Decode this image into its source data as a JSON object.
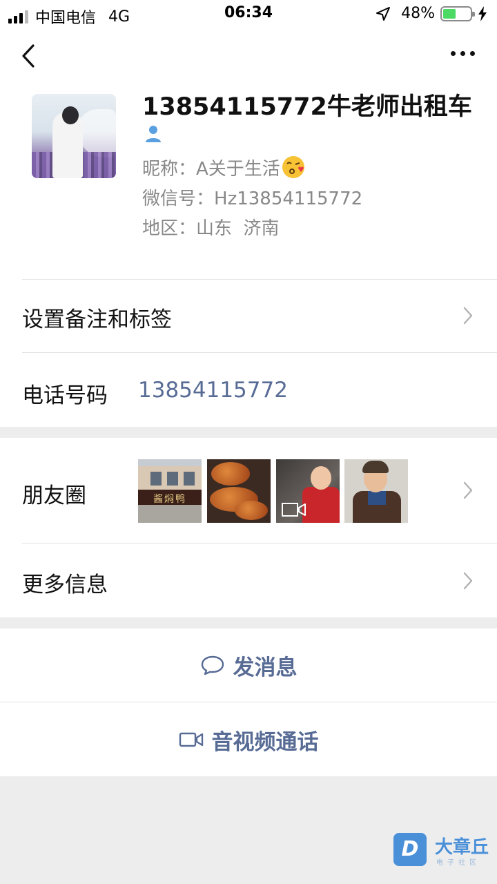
{
  "status_bar": {
    "carrier": "中国电信",
    "network": "4G",
    "time": "06:34",
    "battery": "48%",
    "battery_level": 0.48,
    "icons": [
      "signal-icon",
      "location-arrow-icon",
      "battery-icon",
      "charging-bolt-icon"
    ]
  },
  "nav": {
    "back_icon": "chevron-left-icon",
    "more_icon": "more-dots-icon"
  },
  "profile": {
    "name": "13854115772牛老师出租车",
    "gender_icon": "person-icon",
    "nickname_label": "昵称：",
    "nickname": "A关于生活",
    "nickname_emoji": "kissing-face-emoji",
    "wxid_label": "微信号：",
    "wxid": "Hz13854115772",
    "region_label": "地区：",
    "region": "山东  济南"
  },
  "rows": {
    "remark_label": "设置备注和标签",
    "phone_label": "电话号码",
    "phone_value": "13854115772",
    "moments_label": "朋友圈",
    "more_info_label": "更多信息"
  },
  "moments": {
    "thumb1_sign": "酱焖鸭"
  },
  "actions": {
    "message_label": "发消息",
    "call_label": "音视频通话"
  },
  "watermark": {
    "logo_letter": "D",
    "text": "大章丘",
    "subtext": "电子社区"
  },
  "colors": {
    "link": "#576b95",
    "background": "#ededed",
    "battery": "#4cd964",
    "watermark": "#4a90d9"
  }
}
